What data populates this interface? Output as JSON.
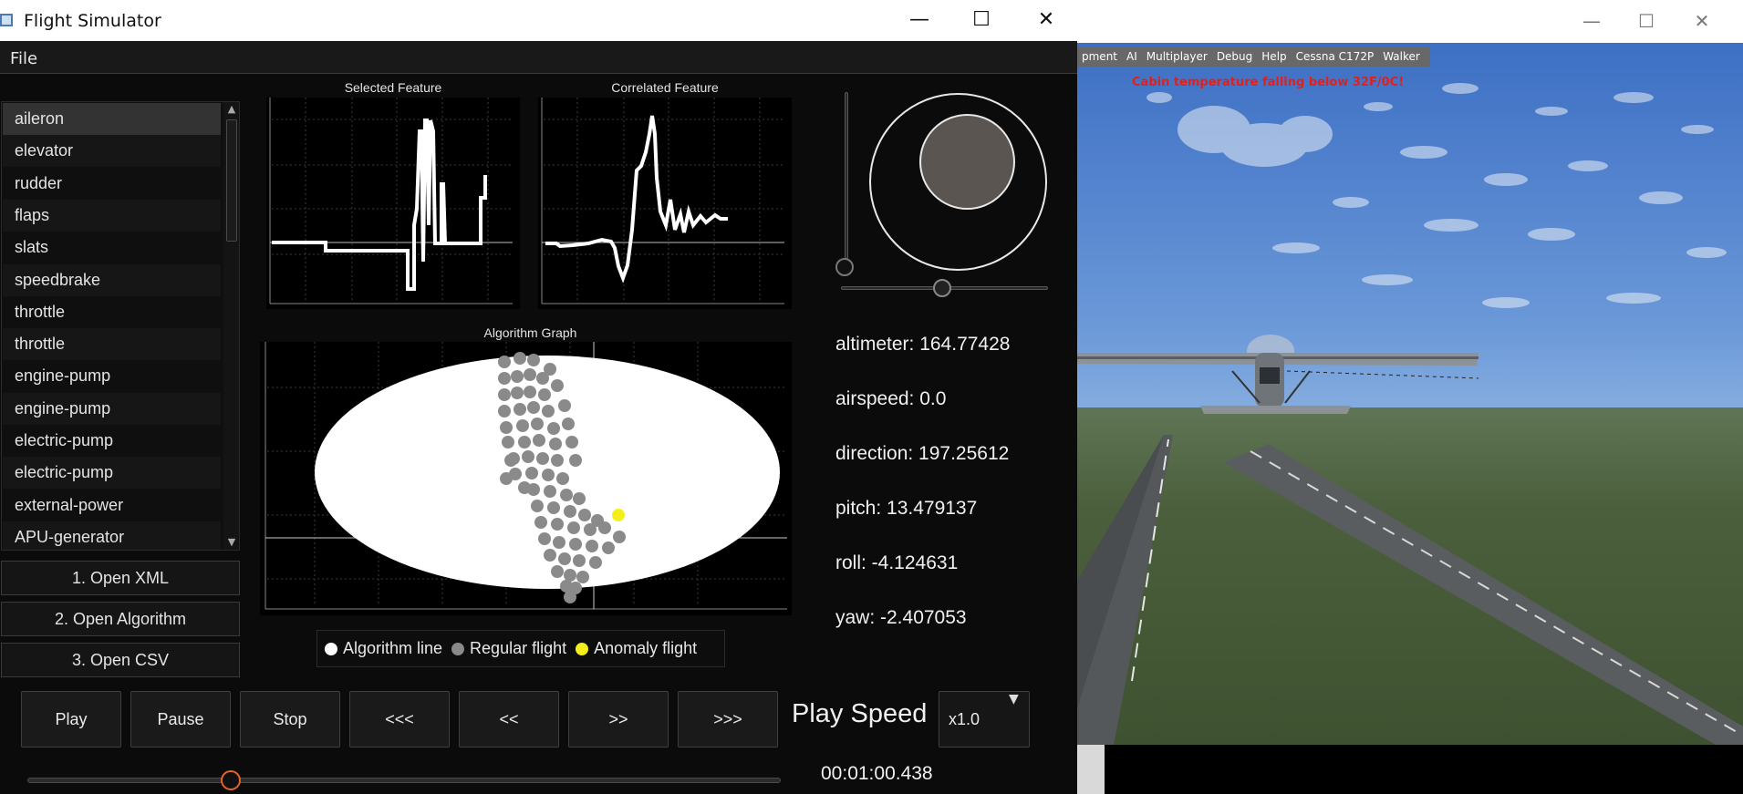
{
  "window": {
    "title": "Flight Simulator",
    "menu_file": "File",
    "minimize": "—",
    "maximize": "☐",
    "close": "✕"
  },
  "features": [
    "aileron",
    "elevator",
    "rudder",
    "flaps",
    "slats",
    "speedbrake",
    "throttle",
    "throttle",
    "engine-pump",
    "engine-pump",
    "electric-pump",
    "electric-pump",
    "external-power",
    "APU-generator"
  ],
  "selected_feature_index": 0,
  "side_buttons": {
    "open_xml": "1. Open XML",
    "open_algorithm": "2. Open Algorithm",
    "open_csv": "3. Open CSV"
  },
  "graphs": {
    "selected_title": "Selected Feature",
    "correlated_title": "Correlated Feature",
    "algorithm_title": "Algorithm Graph"
  },
  "legend": {
    "algorithm_line": "Algorithm line",
    "regular_flight": "Regular flight",
    "anomaly_flight": "Anomaly flight"
  },
  "colors": {
    "algorithm_line": "#ffffff",
    "regular_flight": "#8a8a8a",
    "anomaly_flight": "#f4ef1a",
    "timeline_knob": "#e2642c",
    "alert_text": "#e0201c"
  },
  "stats": {
    "altimeter": "altimeter: 164.77428",
    "airspeed": "airspeed: 0.0",
    "direction": "direction: 197.25612",
    "pitch": "pitch: 13.479137",
    "roll": "roll: -4.124631",
    "yaw": "yaw: -2.407053"
  },
  "playback": {
    "play": "Play",
    "pause": "Pause",
    "stop": "Stop",
    "fast_back": "<<<",
    "back": "<<",
    "forward": ">>",
    "fast_forward": ">>>",
    "speed_label": "Play Speed",
    "speed_value": "x1.0",
    "time": "00:01:00.438",
    "progress": 0.27
  },
  "controls": {
    "throttle_level": 0.0,
    "rudder_level": 0.49
  },
  "flightgear": {
    "menu": [
      "pment",
      "AI",
      "Multiplayer",
      "Debug",
      "Help",
      "Cessna C172P",
      "Walker"
    ],
    "alert": "Cabin temperature falling below 32F/0C!",
    "minimize": "—",
    "maximize": "☐",
    "close": "✕"
  }
}
